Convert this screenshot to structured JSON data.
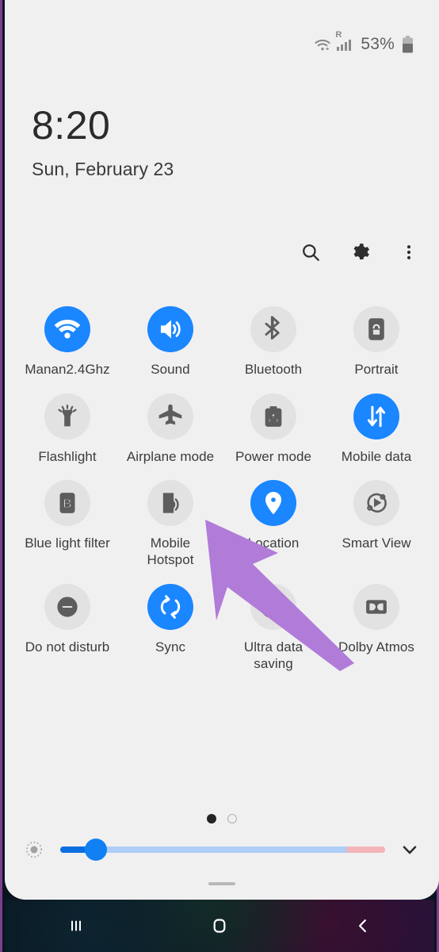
{
  "statusbar": {
    "wifi_icon": "wifi-icon",
    "roaming_badge": "R",
    "signal_icon": "cellular-signal-icon",
    "battery_percent": "53%",
    "battery_icon": "battery-icon"
  },
  "clock": {
    "time": "8:20",
    "date": "Sun, February 23"
  },
  "actions": [
    {
      "name": "search-button",
      "icon": "search-icon"
    },
    {
      "name": "settings-button",
      "icon": "gear-icon"
    },
    {
      "name": "more-options-button",
      "icon": "three-dots-icon"
    }
  ],
  "tiles": [
    {
      "label": "Manan2.4Ghz",
      "icon": "wifi-icon",
      "active": true
    },
    {
      "label": "Sound",
      "icon": "sound-icon",
      "active": true
    },
    {
      "label": "Bluetooth",
      "icon": "bluetooth-icon",
      "active": false
    },
    {
      "label": "Portrait",
      "icon": "rotation-lock-icon",
      "active": false
    },
    {
      "label": "Flashlight",
      "icon": "flashlight-icon",
      "active": false
    },
    {
      "label": "Airplane mode",
      "icon": "airplane-icon",
      "active": false
    },
    {
      "label": "Power mode",
      "icon": "power-mode-icon",
      "active": false
    },
    {
      "label": "Mobile data",
      "icon": "mobile-data-icon",
      "active": true
    },
    {
      "label": "Blue light filter",
      "icon": "blue-light-filter-icon",
      "active": false
    },
    {
      "label": "Mobile Hotspot",
      "icon": "hotspot-icon",
      "active": false
    },
    {
      "label": "Location",
      "icon": "location-icon",
      "active": true
    },
    {
      "label": "Smart View",
      "icon": "smart-view-icon",
      "active": false
    },
    {
      "label": "Do not disturb",
      "icon": "do-not-disturb-icon",
      "active": false
    },
    {
      "label": "Sync",
      "icon": "sync-icon",
      "active": true
    },
    {
      "label": "Ultra data saving",
      "icon": "ultra-data-saving-icon",
      "active": false
    },
    {
      "label": "Dolby Atmos",
      "icon": "dolby-atmos-icon",
      "active": false
    }
  ],
  "pager": {
    "pages": 2,
    "current": 1
  },
  "brightness": {
    "sun_icon": "brightness-icon",
    "value_percent": 11,
    "warn_start_percent": 88,
    "expand_icon": "chevron-down-icon"
  },
  "navbar": [
    {
      "name": "recents-button",
      "icon": "recents-icon"
    },
    {
      "name": "home-button",
      "icon": "home-icon"
    },
    {
      "name": "back-button",
      "icon": "back-icon"
    }
  ],
  "annotation": {
    "pointer": "purple-arrow-pointer",
    "color": "#b07cd8"
  },
  "colors": {
    "accent": "#1a86ff",
    "tile_off": "#e3e2e3",
    "panel_bg": "#f1f0f1",
    "border": "#7b3f8f"
  }
}
